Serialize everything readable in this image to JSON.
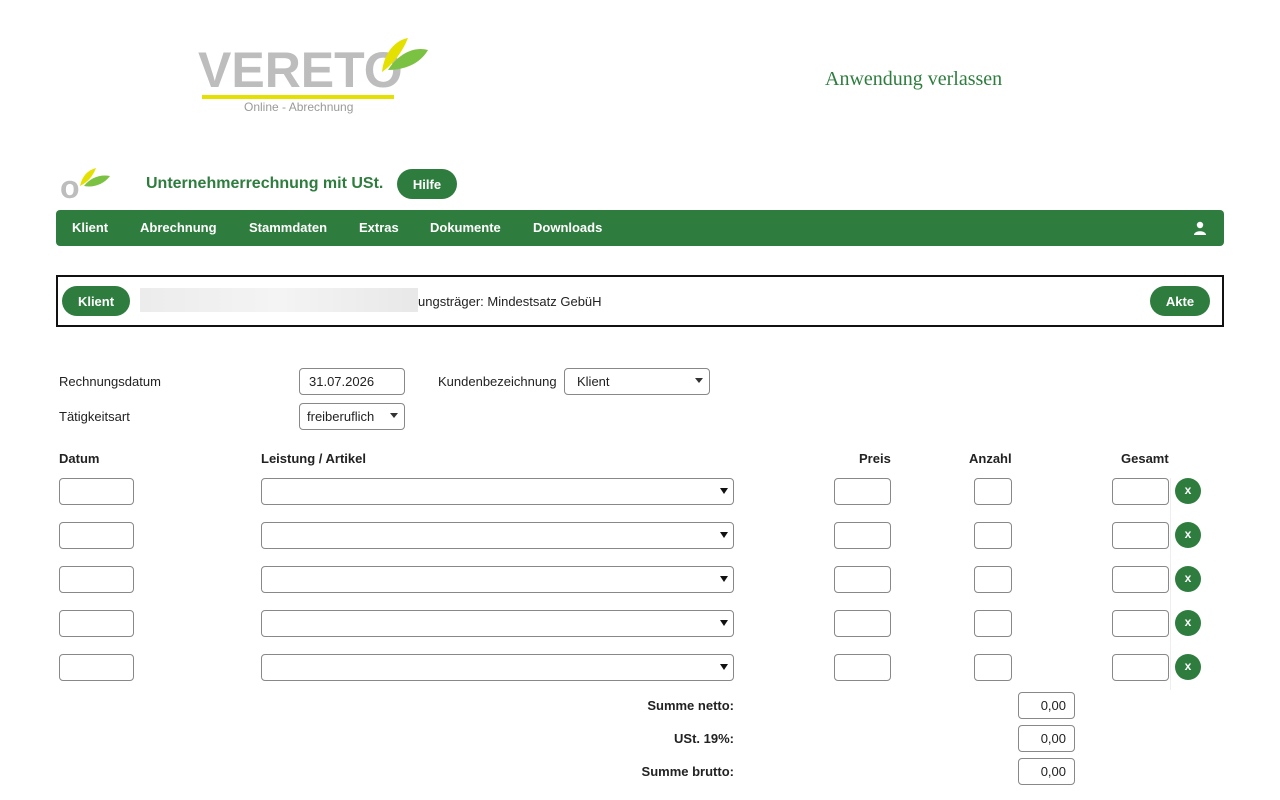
{
  "header": {
    "logo": {
      "text": "VERETO",
      "subtitle": "Online - Abrechnung"
    },
    "exit_link": "Anwendung verlassen"
  },
  "page": {
    "title": "Unternehmerrechnung mit USt.",
    "help_label": "Hilfe"
  },
  "nav": {
    "items": [
      "Klient",
      "Abrechnung",
      "Stammdaten",
      "Extras",
      "Dokumente",
      "Downloads"
    ],
    "user_icon": "user-icon"
  },
  "client_bar": {
    "client_label": "Klient",
    "client_info": "ungsträger: Mindestsatz GebüH",
    "akte_label": "Akte"
  },
  "form": {
    "invoice_date_label": "Rechnungsdatum",
    "invoice_date_value": "31.07.2026",
    "customer_label": "Kundenbezeichnung",
    "customer_value": "Klient",
    "activity_label": "Tätigkeitsart",
    "activity_value": "freiberuflich"
  },
  "table": {
    "headers": {
      "date": "Datum",
      "service": "Leistung / Artikel",
      "price": "Preis",
      "qty": "Anzahl",
      "total": "Gesamt"
    },
    "rows": [
      {
        "date": "",
        "service": "",
        "price": "",
        "qty": "",
        "total": "",
        "remove": "x"
      },
      {
        "date": "",
        "service": "",
        "price": "",
        "qty": "",
        "total": "",
        "remove": "x"
      },
      {
        "date": "",
        "service": "",
        "price": "",
        "qty": "",
        "total": "",
        "remove": "x"
      },
      {
        "date": "",
        "service": "",
        "price": "",
        "qty": "",
        "total": "",
        "remove": "x"
      },
      {
        "date": "",
        "service": "",
        "price": "",
        "qty": "",
        "total": "",
        "remove": "x"
      }
    ]
  },
  "totals": {
    "net_label": "Summe netto:",
    "net_value": "0,00",
    "vat_label": "USt. 19%:",
    "vat_value": "0,00",
    "gross_label": "Summe brutto:",
    "gross_value": "0,00"
  },
  "colors": {
    "brand_green": "#2e7d3e",
    "logo_yellow": "#e4e000",
    "logo_gray": "#bdbdbd"
  }
}
